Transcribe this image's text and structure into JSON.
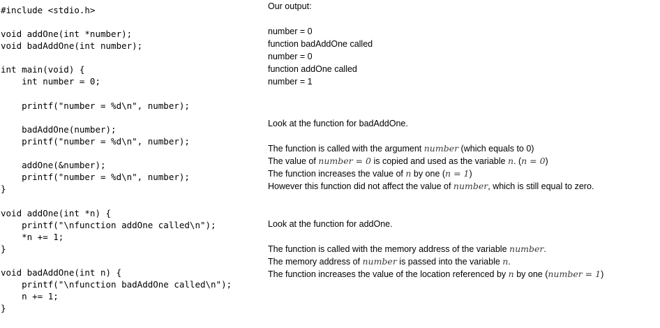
{
  "code": {
    "lines": [
      "#include <stdio.h>",
      "",
      "void addOne(int *number);",
      "void badAddOne(int number);",
      "",
      "int main(void) {",
      "    int number = 0;",
      "",
      "    printf(\"number = %d\\n\", number);",
      "",
      "    badAddOne(number);",
      "    printf(\"number = %d\\n\", number);",
      "",
      "    addOne(&number);",
      "    printf(\"number = %d\\n\", number);",
      "}",
      "",
      "void addOne(int *n) {",
      "    printf(\"\\nfunction addOne called\\n\");",
      "    *n += 1;",
      "}",
      "",
      "void badAddOne(int n) {",
      "    printf(\"\\nfunction badAddOne called\\n\");",
      "    n += 1;",
      "}"
    ]
  },
  "output": {
    "heading": "Our output:",
    "lines": [
      "number = 0",
      "function badAddOne called",
      "number = 0",
      "function addOne called",
      "number = 1"
    ]
  },
  "bad_explanation": {
    "intro": "Look at the function for badAddOne.",
    "l1_pre": "The function is called with the argument ",
    "l1_var": "number",
    "l1_post": " (which equals to 0)",
    "l2_pre": "The value of ",
    "l2_math": "number = 0",
    "l2_mid": " is copied and used as the variable ",
    "l2_var": "n",
    "l2_mid2": ". (",
    "l2_math2": "n = 0",
    "l2_post": ")",
    "l3_pre": "The function increases the value of ",
    "l3_var": "n",
    "l3_mid": " by one (",
    "l3_math": "n = 1",
    "l3_post": ")",
    "l4_pre": "However this function did not affect the value of ",
    "l4_var": "number",
    "l4_post": ", which is still equal to zero."
  },
  "good_explanation": {
    "intro": "Look at the function for addOne.",
    "l1_pre": "The function is called with the memory address of the variable ",
    "l1_var": "number",
    "l1_post": ".",
    "l2_pre": "The memory address of ",
    "l2_var": "number",
    "l2_mid": " is passed into the variable ",
    "l2_var2": "n",
    "l2_post": ".",
    "l3_pre": "The function increases the value of the location referenced by ",
    "l3_var": "n",
    "l3_mid": " by one (",
    "l3_math": "number = 1",
    "l3_post": ")"
  }
}
